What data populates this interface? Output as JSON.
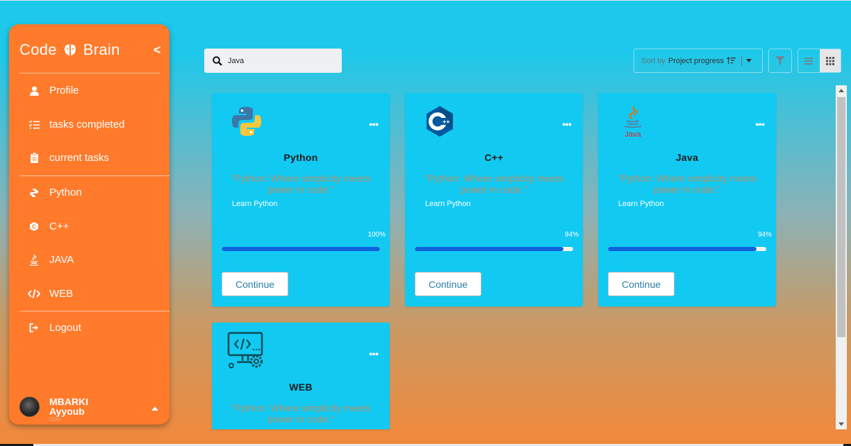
{
  "sidebar": {
    "brand_left": "Code",
    "brand_right": "Brain",
    "collapse": "<",
    "items": [
      {
        "label": "Profile",
        "icon": "user-icon"
      },
      {
        "label": "tasks completed",
        "icon": "list-check-icon"
      },
      {
        "label": "current tasks",
        "icon": "clipboard-icon"
      },
      {
        "label": "Python",
        "icon": "python-icon"
      },
      {
        "label": "C++",
        "icon": "cplusplus-icon"
      },
      {
        "label": "JAVA",
        "icon": "java-icon"
      },
      {
        "label": "WEB",
        "icon": "code-icon"
      },
      {
        "label": "Logout",
        "icon": "logout-icon"
      }
    ],
    "user": {
      "first": "MBARKI",
      "last": "Ayyoub",
      "role": "User"
    }
  },
  "search": {
    "value": "Java"
  },
  "sort": {
    "label": "Sort by",
    "value": "Project progress"
  },
  "cards": [
    {
      "title": "Python",
      "quote": "\"Python: Where simplicity meets power in code.\"",
      "learn": "Learn Python",
      "progress_label": "100%",
      "progress": 1.0,
      "button": "Continue",
      "icon": "python-logo-icon"
    },
    {
      "title": "C++",
      "quote": "\"Python: Where simplicity meets power in code.\"",
      "learn": "Learn Python",
      "progress_label": "94%",
      "progress": 0.94,
      "button": "Continue",
      "icon": "cplusplus-logo-icon"
    },
    {
      "title": "Java",
      "quote": "\"Python: Where simplicity meets power in code.\"",
      "learn": "Learn Python",
      "progress_label": "94%",
      "progress": 0.94,
      "button": "Continue",
      "icon": "java-logo-icon"
    },
    {
      "title": "WEB",
      "quote": "\"Python: Where simplicity meets power in code.\"",
      "icon": "web-dev-icon"
    }
  ],
  "colors": {
    "sidebar": "#ff7a2a",
    "card": "#12c9f2",
    "progress": "#0e63d8"
  }
}
